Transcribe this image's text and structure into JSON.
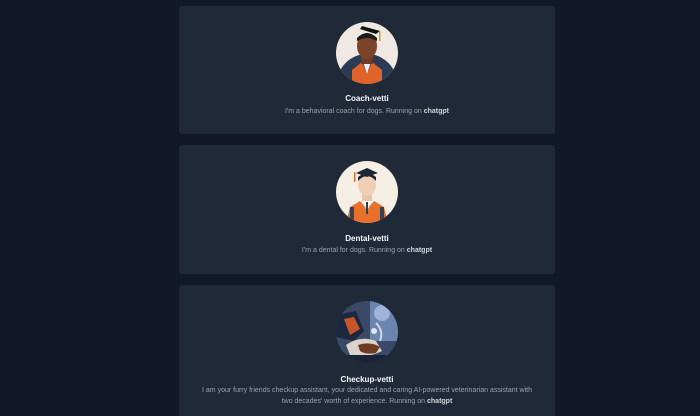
{
  "bots": [
    {
      "name": "Coach-vetti",
      "description": "I'm a behavioral coach for dogs. Running on",
      "model": "chatgpt",
      "avatar_icon": "coach-avatar-icon"
    },
    {
      "name": "Dental-vetti",
      "description": "I'm a dental for dogs. Running on",
      "model": "chatgpt",
      "avatar_icon": "dental-avatar-icon"
    },
    {
      "name": "Checkup-vetti",
      "description": "I am your furry friends checkup assistant, your dedicated and caring AI-powered veterinarian assistant with two decades' worth of experience. Running on",
      "model": "chatgpt",
      "avatar_icon": "checkup-avatar-icon"
    }
  ],
  "colors": {
    "background": "#111827",
    "card": "#1f2937",
    "accent_orange": "#e8702a"
  }
}
